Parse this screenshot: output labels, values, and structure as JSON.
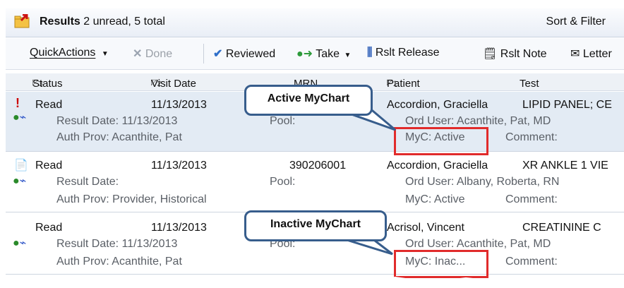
{
  "header": {
    "title_bold": "Results",
    "title_rest": "2 unread, 5 total",
    "sort_filter": "Sort & Filter"
  },
  "toolbar": {
    "quickactions": "QuickActions",
    "done": "Done",
    "reviewed": "Reviewed",
    "take": "Take",
    "rslt_release": "Rslt Release",
    "rslt_note": "Rslt Note",
    "letter": "Letter"
  },
  "columns": {
    "status": "Status",
    "visit_date": "Visit Date",
    "mrn": "MRN",
    "patient": "Patient",
    "test": "Test",
    "status_sort": "3",
    "visit_sort": "2",
    "patient_sort": "1"
  },
  "rows": [
    {
      "status": "Read",
      "visit_date": "11/13/2013",
      "mrn": "",
      "patient": "Accordion, Graciella",
      "test": "LIPID PANEL; CE",
      "result_date": "Result Date: 11/13/2013",
      "pool": "Pool:",
      "ord_user": "Ord User: Acanthite, Pat, MD",
      "auth_prov": "Auth Prov: Acanthite, Pat",
      "myc": "MyC: Active",
      "comment": "Comment:"
    },
    {
      "status": "Read",
      "visit_date": "11/13/2013",
      "mrn": "390206001",
      "patient": "Accordion, Graciella",
      "test": "XR ANKLE 1 VIE",
      "result_date": "Result Date:",
      "pool": "Pool:",
      "ord_user": "Ord User: Albany, Roberta, RN",
      "auth_prov": "Auth Prov: Provider, Historical",
      "myc": "MyC: Active",
      "comment": "Comment:"
    },
    {
      "status": "Read",
      "visit_date": "11/13/2013",
      "mrn": "",
      "patient": "Acrisol, Vincent",
      "test": "CREATININE C",
      "result_date": "Result Date: 11/13/2013",
      "pool": "Pool:",
      "ord_user": "Ord User: Acanthite, Pat, MD",
      "auth_prov": "Auth Prov: Acanthite, Pat",
      "myc": "MyC: Inac...",
      "comment": "Comment:"
    }
  ],
  "callouts": {
    "active": "Active MyChart",
    "inactive": "Inactive MyChart"
  },
  "colors": {
    "callout_border": "#375d8c",
    "highlight_red": "#e12b2b",
    "selected_row": "#e3ebf4",
    "alert_red": "#cc0000"
  },
  "icons": [
    "results-folder-icon",
    "close-x-icon",
    "checkmark-icon",
    "take-arrow-icon",
    "release-icon",
    "note-icon",
    "letter-icon",
    "exclamation-icon",
    "mychart-status-icon",
    "document-icon"
  ]
}
